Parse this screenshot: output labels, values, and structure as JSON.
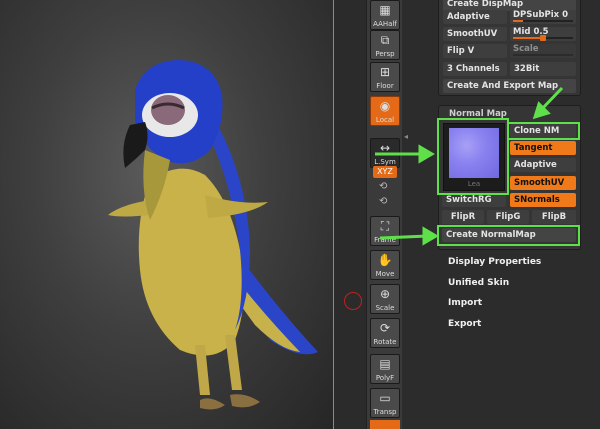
{
  "toolbar": [
    {
      "label": "AAHalf",
      "icon": "grid-icon"
    },
    {
      "label": "Persp",
      "icon": "perspective-icon"
    },
    {
      "label": "Floor",
      "icon": "floor-grid-icon"
    },
    {
      "label": "Local",
      "icon": "local-icon",
      "active": true
    },
    {
      "label": "L.Sym",
      "icon": "symmetry-icon"
    },
    {
      "label": "Frame",
      "icon": "frame-icon"
    },
    {
      "label": "Move",
      "icon": "hand-icon"
    },
    {
      "label": "Scale",
      "icon": "magnify-icon"
    },
    {
      "label": "Rotate",
      "icon": "rotate-icon"
    },
    {
      "label": "PolyF",
      "icon": "polyframe-icon"
    },
    {
      "label": "Transp",
      "icon": "transparency-icon"
    }
  ],
  "xyz_label": "XYZ",
  "displacement": {
    "create_disp_map": "Create DispMap",
    "adaptive": "Adaptive",
    "dpsubpix_label": "DPSubPix",
    "dpsubpix_value": "0",
    "smooth_uv": "SmoothUV",
    "mid_label": "Mid",
    "mid_value": "0.5",
    "mid_fill": 0.5,
    "flip_v": "Flip V",
    "scale_label": "Scale",
    "channels": "3 Channels",
    "bit": "32Bit",
    "create_export": "Create And Export Map"
  },
  "normal_map": {
    "title": "Normal Map",
    "thumb_caption": "Lea",
    "clone_nm": "Clone NM",
    "tangent": "Tangent",
    "adaptive": "Adaptive",
    "smooth_uv": "SmoothUV",
    "switch_rg": "SwitchRG",
    "snormals": "SNormals",
    "flip_r": "FlipR",
    "flip_g": "FlipG",
    "flip_b": "FlipB",
    "create": "Create NormalMap"
  },
  "menu": {
    "display_properties": "Display Properties",
    "unified_skin": "Unified Skin",
    "import": "Import",
    "export": "Export"
  },
  "colors": {
    "accent": "#e46a18",
    "highlight": "#5fe04a",
    "parrot_blue": "#2540c8",
    "parrot_yellow": "#c9b24a"
  }
}
